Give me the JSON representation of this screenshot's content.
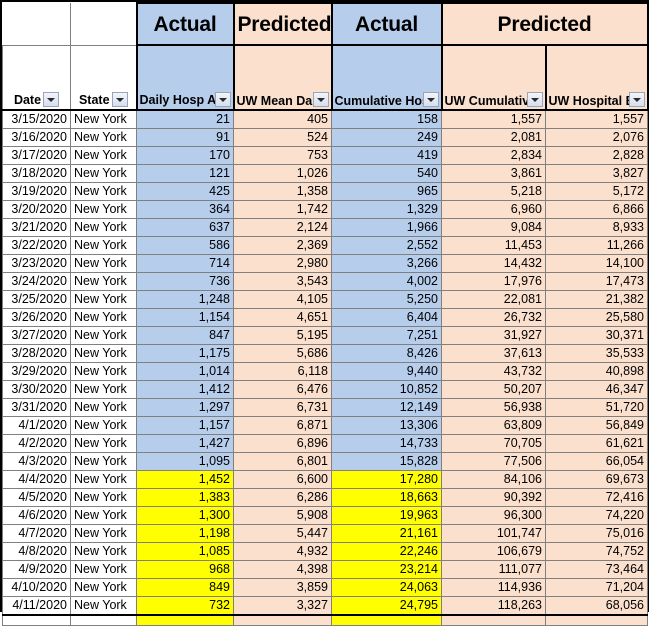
{
  "colors": {
    "actual_fill": "#b7cdec",
    "predicted_fill": "#fce0ce",
    "highlight_fill": "#ffff00",
    "grid_line": "#808080",
    "border": "#000000"
  },
  "group_header": {
    "blank_date": "",
    "blank_state": "",
    "groups": [
      {
        "label": "Actual",
        "span": 1,
        "fill": "blue"
      },
      {
        "label": "Predicted",
        "span": 1,
        "fill": "peach"
      },
      {
        "label": "Actual",
        "span": 1,
        "fill": "blue"
      },
      {
        "label": "Predicted",
        "span": 2,
        "fill": "peach"
      }
    ]
  },
  "columns": [
    {
      "key": "date",
      "label": "Date",
      "fill": "white",
      "filter": true,
      "align": "right"
    },
    {
      "key": "state",
      "label": "State",
      "fill": "white",
      "filter": true,
      "align": "left"
    },
    {
      "key": "dha",
      "label": "Daily Hosp Admit",
      "fill": "blue",
      "filter": true,
      "align": "right"
    },
    {
      "key": "uwmda",
      "label": "UW Mean Daily Admissions",
      "fill": "peach",
      "filter": true,
      "align": "right"
    },
    {
      "key": "cha",
      "label": "Cumulative Hosp Admit",
      "fill": "blue",
      "filter": true,
      "align": "right"
    },
    {
      "key": "uwcha",
      "label": "UW Cumulative Hosp Admit",
      "fill": "peach",
      "filter": true,
      "align": "right"
    },
    {
      "key": "uwhbp",
      "label": "UW Hospital Beds Predict",
      "fill": "peach",
      "filter": true,
      "align": "right"
    }
  ],
  "rows": [
    {
      "date": "3/15/2020",
      "state": "New York",
      "dha": "21",
      "uwmda": "405",
      "cha": "158",
      "uwcha": "1,557",
      "uwhbp": "1,557",
      "highlight": false
    },
    {
      "date": "3/16/2020",
      "state": "New York",
      "dha": "91",
      "uwmda": "524",
      "cha": "249",
      "uwcha": "2,081",
      "uwhbp": "2,076",
      "highlight": false
    },
    {
      "date": "3/17/2020",
      "state": "New York",
      "dha": "170",
      "uwmda": "753",
      "cha": "419",
      "uwcha": "2,834",
      "uwhbp": "2,828",
      "highlight": false
    },
    {
      "date": "3/18/2020",
      "state": "New York",
      "dha": "121",
      "uwmda": "1,026",
      "cha": "540",
      "uwcha": "3,861",
      "uwhbp": "3,827",
      "highlight": false
    },
    {
      "date": "3/19/2020",
      "state": "New York",
      "dha": "425",
      "uwmda": "1,358",
      "cha": "965",
      "uwcha": "5,218",
      "uwhbp": "5,172",
      "highlight": false
    },
    {
      "date": "3/20/2020",
      "state": "New York",
      "dha": "364",
      "uwmda": "1,742",
      "cha": "1,329",
      "uwcha": "6,960",
      "uwhbp": "6,866",
      "highlight": false
    },
    {
      "date": "3/21/2020",
      "state": "New York",
      "dha": "637",
      "uwmda": "2,124",
      "cha": "1,966",
      "uwcha": "9,084",
      "uwhbp": "8,933",
      "highlight": false
    },
    {
      "date": "3/22/2020",
      "state": "New York",
      "dha": "586",
      "uwmda": "2,369",
      "cha": "2,552",
      "uwcha": "11,453",
      "uwhbp": "11,266",
      "highlight": false
    },
    {
      "date": "3/23/2020",
      "state": "New York",
      "dha": "714",
      "uwmda": "2,980",
      "cha": "3,266",
      "uwcha": "14,432",
      "uwhbp": "14,100",
      "highlight": false
    },
    {
      "date": "3/24/2020",
      "state": "New York",
      "dha": "736",
      "uwmda": "3,543",
      "cha": "4,002",
      "uwcha": "17,976",
      "uwhbp": "17,473",
      "highlight": false
    },
    {
      "date": "3/25/2020",
      "state": "New York",
      "dha": "1,248",
      "uwmda": "4,105",
      "cha": "5,250",
      "uwcha": "22,081",
      "uwhbp": "21,382",
      "highlight": false
    },
    {
      "date": "3/26/2020",
      "state": "New York",
      "dha": "1,154",
      "uwmda": "4,651",
      "cha": "6,404",
      "uwcha": "26,732",
      "uwhbp": "25,580",
      "highlight": false
    },
    {
      "date": "3/27/2020",
      "state": "New York",
      "dha": "847",
      "uwmda": "5,195",
      "cha": "7,251",
      "uwcha": "31,927",
      "uwhbp": "30,371",
      "highlight": false
    },
    {
      "date": "3/28/2020",
      "state": "New York",
      "dha": "1,175",
      "uwmda": "5,686",
      "cha": "8,426",
      "uwcha": "37,613",
      "uwhbp": "35,533",
      "highlight": false
    },
    {
      "date": "3/29/2020",
      "state": "New York",
      "dha": "1,014",
      "uwmda": "6,118",
      "cha": "9,440",
      "uwcha": "43,732",
      "uwhbp": "40,898",
      "highlight": false
    },
    {
      "date": "3/30/2020",
      "state": "New York",
      "dha": "1,412",
      "uwmda": "6,476",
      "cha": "10,852",
      "uwcha": "50,207",
      "uwhbp": "46,347",
      "highlight": false
    },
    {
      "date": "3/31/2020",
      "state": "New York",
      "dha": "1,297",
      "uwmda": "6,731",
      "cha": "12,149",
      "uwcha": "56,938",
      "uwhbp": "51,720",
      "highlight": false
    },
    {
      "date": "4/1/2020",
      "state": "New York",
      "dha": "1,157",
      "uwmda": "6,871",
      "cha": "13,306",
      "uwcha": "63,809",
      "uwhbp": "56,849",
      "highlight": false
    },
    {
      "date": "4/2/2020",
      "state": "New York",
      "dha": "1,427",
      "uwmda": "6,896",
      "cha": "14,733",
      "uwcha": "70,705",
      "uwhbp": "61,621",
      "highlight": false
    },
    {
      "date": "4/3/2020",
      "state": "New York",
      "dha": "1,095",
      "uwmda": "6,801",
      "cha": "15,828",
      "uwcha": "77,506",
      "uwhbp": "66,054",
      "highlight": false
    },
    {
      "date": "4/4/2020",
      "state": "New York",
      "dha": "1,452",
      "uwmda": "6,600",
      "cha": "17,280",
      "uwcha": "84,106",
      "uwhbp": "69,673",
      "highlight": true
    },
    {
      "date": "4/5/2020",
      "state": "New York",
      "dha": "1,383",
      "uwmda": "6,286",
      "cha": "18,663",
      "uwcha": "90,392",
      "uwhbp": "72,416",
      "highlight": true
    },
    {
      "date": "4/6/2020",
      "state": "New York",
      "dha": "1,300",
      "uwmda": "5,908",
      "cha": "19,963",
      "uwcha": "96,300",
      "uwhbp": "74,220",
      "highlight": true
    },
    {
      "date": "4/7/2020",
      "state": "New York",
      "dha": "1,198",
      "uwmda": "5,447",
      "cha": "21,161",
      "uwcha": "101,747",
      "uwhbp": "75,016",
      "highlight": true
    },
    {
      "date": "4/8/2020",
      "state": "New York",
      "dha": "1,085",
      "uwmda": "4,932",
      "cha": "22,246",
      "uwcha": "106,679",
      "uwhbp": "74,752",
      "highlight": true
    },
    {
      "date": "4/9/2020",
      "state": "New York",
      "dha": "968",
      "uwmda": "4,398",
      "cha": "23,214",
      "uwcha": "111,077",
      "uwhbp": "73,464",
      "highlight": true
    },
    {
      "date": "4/10/2020",
      "state": "New York",
      "dha": "849",
      "uwmda": "3,859",
      "cha": "24,063",
      "uwcha": "114,936",
      "uwhbp": "71,204",
      "highlight": true
    },
    {
      "date": "4/11/2020",
      "state": "New York",
      "dha": "732",
      "uwmda": "3,327",
      "cha": "24,795",
      "uwcha": "118,263",
      "uwhbp": "68,056",
      "highlight": true
    }
  ],
  "icons": {
    "filter_dropdown": "filter-dropdown-icon"
  }
}
